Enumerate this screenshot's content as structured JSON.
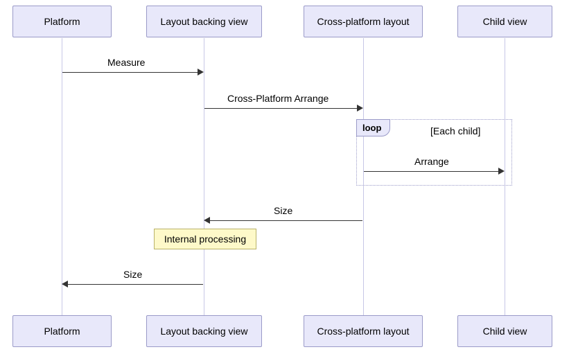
{
  "participants": {
    "p1": "Platform",
    "p2": "Layout backing view",
    "p3": "Cross-platform layout",
    "p4": "Child view"
  },
  "messages": {
    "m1": "Measure",
    "m2": "Cross-Platform Arrange",
    "m3": "Arrange",
    "m4": "Size",
    "m5": "Size"
  },
  "loop": {
    "keyword": "loop",
    "condition": "[Each child]"
  },
  "note": {
    "text": "Internal processing"
  },
  "chart_data": {
    "type": "sequence-diagram",
    "participants": [
      "Platform",
      "Layout backing view",
      "Cross-platform layout",
      "Child view"
    ],
    "steps": [
      {
        "from": "Platform",
        "to": "Layout backing view",
        "label": "Measure"
      },
      {
        "from": "Layout backing view",
        "to": "Cross-platform layout",
        "label": "Cross-Platform Arrange"
      },
      {
        "fragment": "loop",
        "condition": "Each child",
        "steps": [
          {
            "from": "Cross-platform layout",
            "to": "Child view",
            "label": "Arrange"
          }
        ]
      },
      {
        "from": "Cross-platform layout",
        "to": "Layout backing view",
        "label": "Size"
      },
      {
        "note": "Internal processing",
        "over": "Layout backing view"
      },
      {
        "from": "Layout backing view",
        "to": "Platform",
        "label": "Size"
      }
    ]
  }
}
